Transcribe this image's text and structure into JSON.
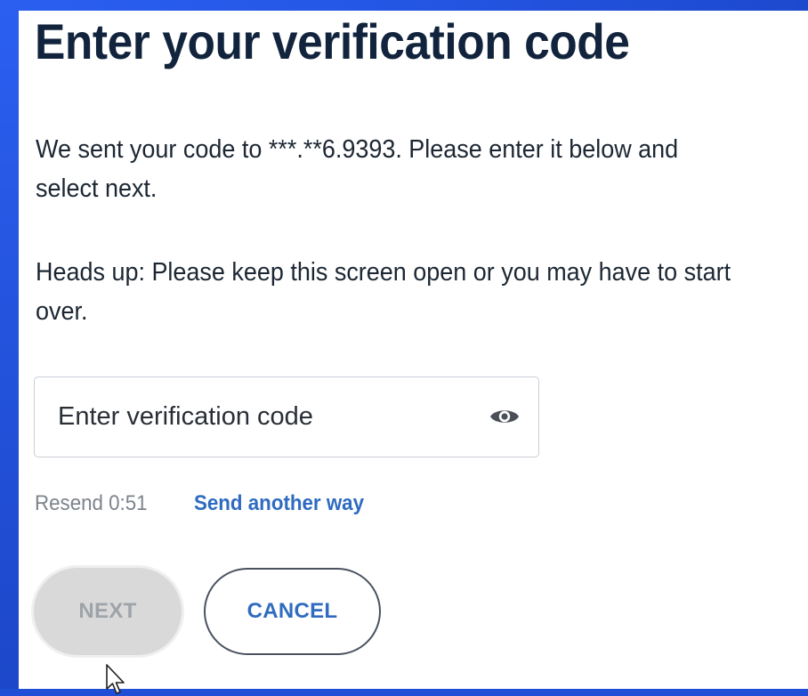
{
  "page": {
    "title": "Enter your verification code",
    "message": "We sent your code to ***.**6.9393. Please enter it below and select next.",
    "heads_up": "Heads up: Please keep this screen open or you may have to start over."
  },
  "code_field": {
    "placeholder": "Enter verification code",
    "value": "",
    "toggle_icon": "eye-icon"
  },
  "resend": {
    "countdown_text": "Resend 0:51",
    "alternate_link": "Send another way"
  },
  "actions": {
    "next_label": "NEXT",
    "cancel_label": "CANCEL"
  },
  "colors": {
    "frame": "#1f4fd6",
    "heading": "#12243d",
    "link": "#2f6bc0",
    "disabled_button": "#d9d9d9",
    "muted_text": "#7d848c"
  }
}
